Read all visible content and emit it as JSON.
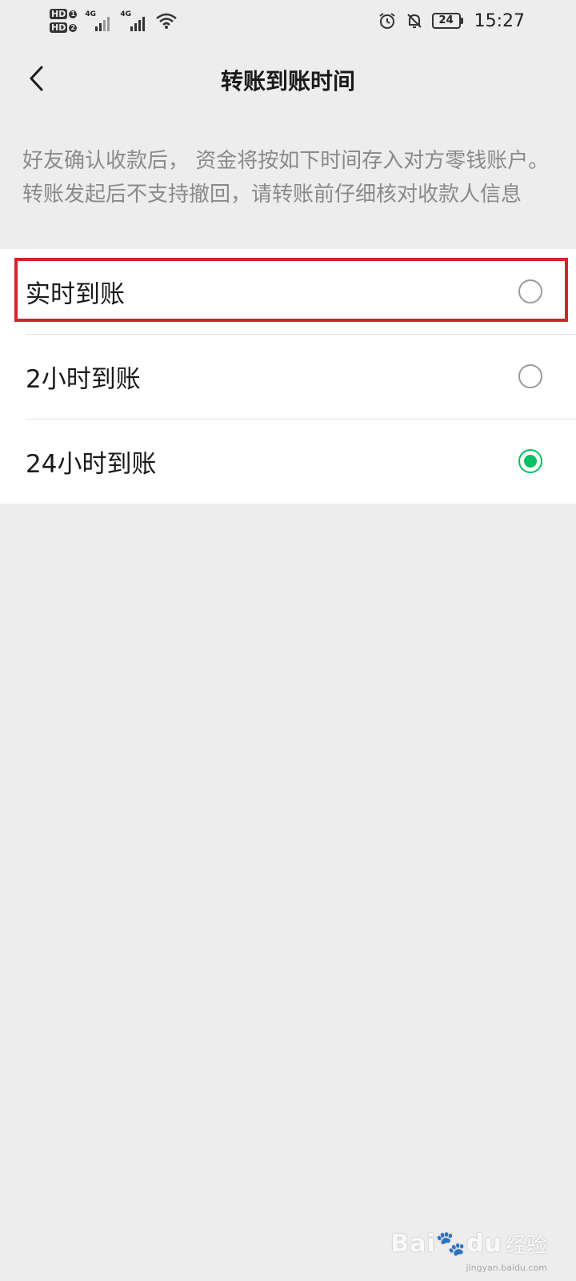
{
  "status_bar": {
    "sim1": "HD",
    "sim1_num": "1",
    "sim2": "HD",
    "sim2_num": "2",
    "net1": "4G",
    "net2": "4G",
    "battery": "24",
    "time": "15:27"
  },
  "nav": {
    "title": "转账到账时间"
  },
  "description": "好友确认收款后， 资金将按如下时间存入对方零钱账户。转账发起后不支持撤回，请转账前仔细核对收款人信息",
  "options": [
    {
      "label": "实时到账",
      "selected": false
    },
    {
      "label": "2小时到账",
      "selected": false
    },
    {
      "label": "24小时到账",
      "selected": true
    }
  ],
  "colors": {
    "accent": "#07c160",
    "highlight": "#d9212c"
  },
  "watermark": {
    "brand": "Bai",
    "brand_mid": "du",
    "sub": "经验",
    "url": "jingyan.baidu.com"
  }
}
